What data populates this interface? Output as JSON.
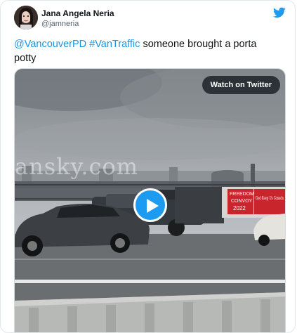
{
  "author": {
    "display_name": "Jana Angela Neria",
    "handle": "@jamneria"
  },
  "tweet": {
    "mention": "@VancouverPD",
    "hashtag": "#VanTraffic",
    "body": " someone brought a porta potty"
  },
  "media": {
    "watch_label": "Watch on Twitter",
    "watermark": "ansky.com",
    "truck_sign_line1": "FREEDOM",
    "truck_sign_line2": "CONVOY",
    "truck_sign_line3": "2022",
    "truck_sign_right": "God Keep Us Canada"
  },
  "colors": {
    "link": "#1b95e0",
    "twitter_blue": "#1d9bf0"
  },
  "icons": {
    "brand": "twitter-bird-icon",
    "play": "play-icon"
  }
}
